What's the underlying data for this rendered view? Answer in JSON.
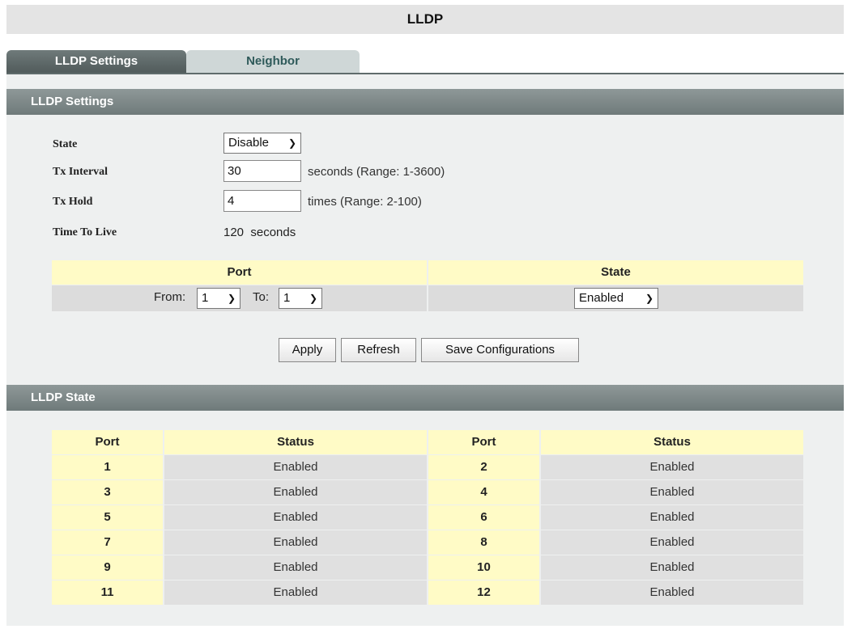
{
  "title": "LLDP",
  "tabs": [
    {
      "label": "LLDP Settings"
    },
    {
      "label": "Neighbor"
    }
  ],
  "settings": {
    "section_title": "LLDP Settings",
    "state_label": "State",
    "state_value": "Disable",
    "tx_interval_label": "Tx Interval",
    "tx_interval_value": "30",
    "tx_interval_hint": "seconds (Range: 1-3600)",
    "tx_hold_label": "Tx Hold",
    "tx_hold_value": "4",
    "tx_hold_hint": "times (Range: 2-100)",
    "ttl_label": "Time To Live",
    "ttl_value": "120  seconds"
  },
  "port_config": {
    "port_header": "Port",
    "state_header": "State",
    "from_label": "From:",
    "from_value": "1",
    "to_label": "To:",
    "to_value": "1",
    "state_value": "Enabled"
  },
  "buttons": {
    "apply": "Apply",
    "refresh": "Refresh",
    "save": "Save Configurations"
  },
  "lldp_state": {
    "section_title": "LLDP State",
    "headers": [
      "Port",
      "Status",
      "Port",
      "Status"
    ],
    "rows": [
      {
        "port_a": "1",
        "status_a": "Enabled",
        "port_b": "2",
        "status_b": "Enabled"
      },
      {
        "port_a": "3",
        "status_a": "Enabled",
        "port_b": "4",
        "status_b": "Enabled"
      },
      {
        "port_a": "5",
        "status_a": "Enabled",
        "port_b": "6",
        "status_b": "Enabled"
      },
      {
        "port_a": "7",
        "status_a": "Enabled",
        "port_b": "8",
        "status_b": "Enabled"
      },
      {
        "port_a": "9",
        "status_a": "Enabled",
        "port_b": "10",
        "status_b": "Enabled"
      },
      {
        "port_a": "11",
        "status_a": "Enabled",
        "port_b": "12",
        "status_b": "Enabled"
      }
    ]
  },
  "icons": {
    "dropdown": "chevron-down-icon"
  },
  "colors": {
    "header_bar": "#7a8585",
    "table_header": "#fffbc6",
    "table_cell": "#e0e0e0"
  }
}
